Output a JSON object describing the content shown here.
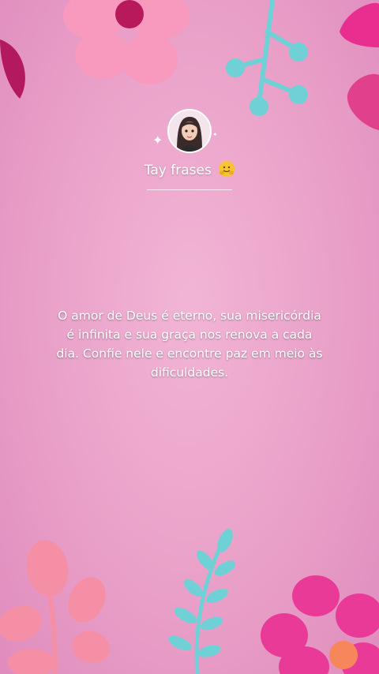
{
  "profile": {
    "name": "Tay frases",
    "avatar_icon": "avatar-girl-icon",
    "emoji_icon": "hugging-face-emoji-icon"
  },
  "quote": {
    "text": "O amor de Deus é eterno, sua misericórdia é infinita e sua graça nos renova a cada dia. Confie nele e encontre paz em meio às dificuldades."
  },
  "colors": {
    "background": "#eba4cb",
    "flower_pink": "#f593b8",
    "flower_magenta": "#e51d8d",
    "stem_teal": "#6fd1d6",
    "leaf_dark": "#b0195e"
  }
}
